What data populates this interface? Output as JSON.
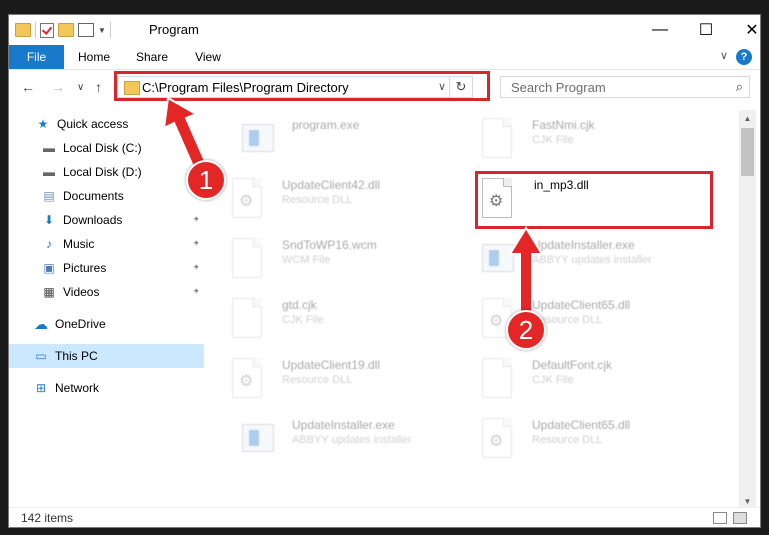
{
  "window": {
    "title": "Program",
    "minimize_glyph": "—",
    "maximize_glyph": "☐",
    "close_glyph": "✕"
  },
  "ribbon": {
    "tabs": [
      "File",
      "Home",
      "Share",
      "View"
    ],
    "collapse_glyph": "∨",
    "help_glyph": "?"
  },
  "address": {
    "path": "C:\\Program Files\\Program Directory",
    "dropdown_glyph": "∨",
    "refresh_glyph": "↻"
  },
  "search": {
    "placeholder": "Search Program",
    "icon": "search-icon"
  },
  "nav_buttons": {
    "back": "←",
    "forward": "→",
    "recent": "∨",
    "up": "↑"
  },
  "sidebar": {
    "items": [
      {
        "label": "Quick access",
        "icon": "star-icon",
        "glyph": "★"
      },
      {
        "label": "Local Disk (C:)",
        "icon": "drive-icon",
        "glyph": "▬"
      },
      {
        "label": "Local Disk (D:)",
        "icon": "drive-icon",
        "glyph": "▬"
      },
      {
        "label": "Documents",
        "icon": "documents-icon",
        "glyph": "▤"
      },
      {
        "label": "Downloads",
        "icon": "downloads-icon",
        "glyph": "⬇"
      },
      {
        "label": "Music",
        "icon": "music-icon",
        "glyph": "♪"
      },
      {
        "label": "Pictures",
        "icon": "pictures-icon",
        "glyph": "▣"
      },
      {
        "label": "Videos",
        "icon": "videos-icon",
        "glyph": "▦"
      },
      {
        "label": "OneDrive",
        "icon": "cloud-icon",
        "glyph": "☁"
      },
      {
        "label": "This PC",
        "icon": "computer-icon",
        "glyph": "▭"
      },
      {
        "label": "Network",
        "icon": "network-icon",
        "glyph": "⊞"
      }
    ],
    "pin_glyph": "✦"
  },
  "files": [
    {
      "name": "program.exe",
      "type": ""
    },
    {
      "name": "FastNmi.cjk",
      "type": "CJK File"
    },
    {
      "name": "UpdateClient42.dll",
      "type": "Resource DLL"
    },
    {
      "name": "in_mp3.dll",
      "type": ""
    },
    {
      "name": "SndToWP16.wcm",
      "type": "WCM File"
    },
    {
      "name": "UpdateInstaller.exe",
      "type": "ABBYY updates installer"
    },
    {
      "name": "gtd.cjk",
      "type": "CJK File"
    },
    {
      "name": "UpdateClient65.dll",
      "type": "Resource DLL"
    },
    {
      "name": "UpdateClient19.dll",
      "type": "Resource DLL"
    },
    {
      "name": "DefaultFont.cjk",
      "type": "CJK File"
    },
    {
      "name": "UpdateInstaller.exe",
      "type": "ABBYY updates installer"
    },
    {
      "name": "UpdateClient65.dll",
      "type": "Resource DLL"
    }
  ],
  "status": {
    "count": "142 items"
  },
  "callouts": {
    "one": "1",
    "two": "2",
    "color": "#e32727"
  },
  "colors": {
    "accent": "#1979ca",
    "highlight": "#d9262e",
    "selected": "#cce8ff"
  }
}
